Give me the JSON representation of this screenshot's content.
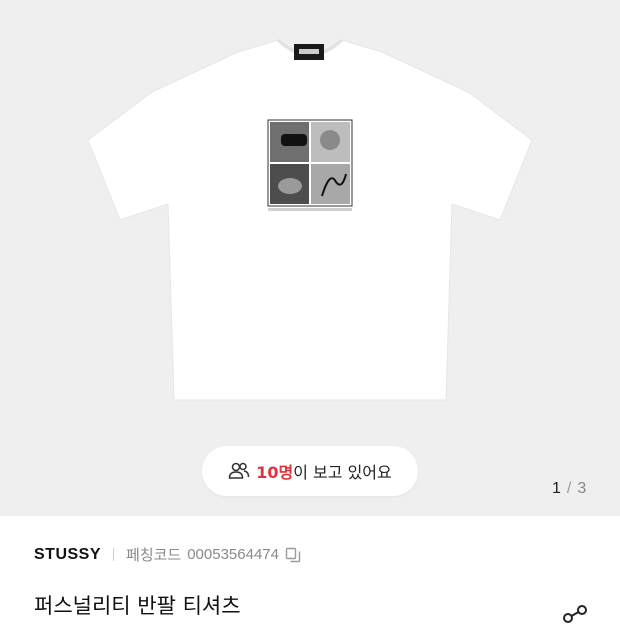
{
  "gallery": {
    "viewers": {
      "count": "10명",
      "text": "이 보고 있어요"
    },
    "pager": {
      "current": "1",
      "separator": "/",
      "total": "3"
    }
  },
  "product": {
    "brand": "STUSSY",
    "code_label": "페칭코드",
    "code_value": "00053564474",
    "title": "퍼스널리티 반팔 티셔츠"
  },
  "icons": {
    "viewers": "people-icon",
    "copy": "copy-icon",
    "share": "share-icon"
  },
  "colors": {
    "accent": "#e0323a",
    "gallery_bg": "#efefef"
  }
}
